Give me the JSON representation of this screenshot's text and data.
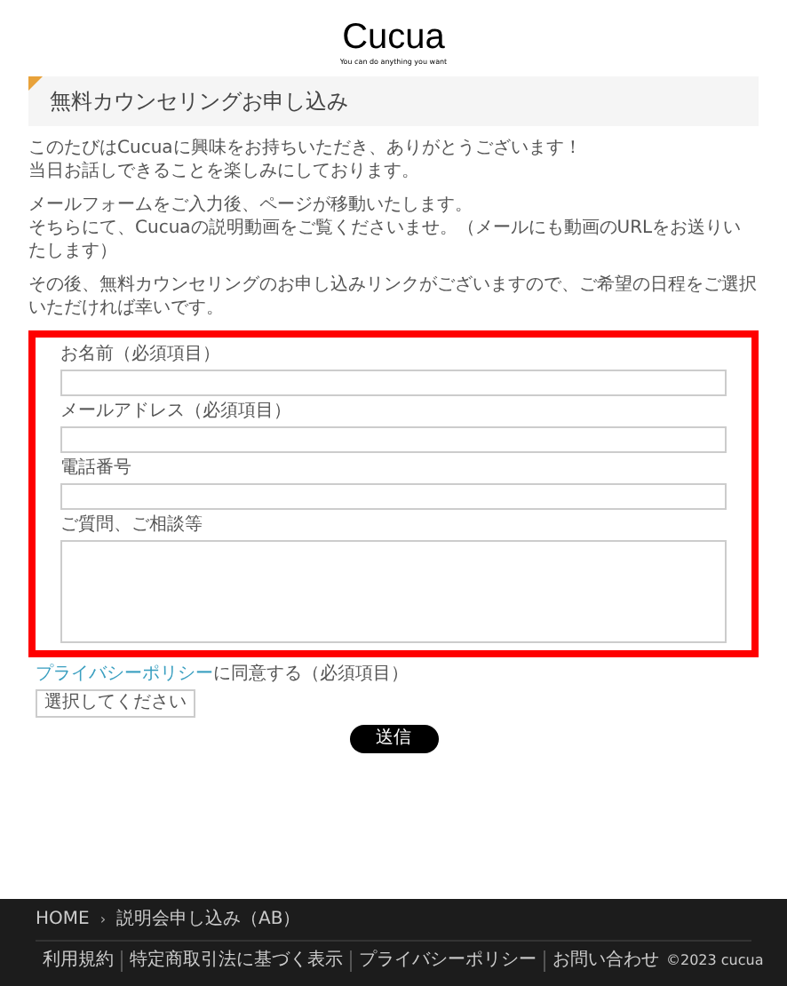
{
  "logo": {
    "text": "Cucua",
    "tagline": "You can do anything you want"
  },
  "heading": "無料カウンセリングお申し込み",
  "paragraphs": [
    {
      "lines": [
        "このたびはCucuaに興味をお持ちいただき、ありがとうございます！",
        "当日お話しできることを楽しみにしております。"
      ]
    },
    {
      "lines": [
        "メールフォームをご入力後、ページが移動いたします。",
        "そちらにて、Cucuaの説明動画をご覧くださいませ。（メールにも動画のURLをお送りいたします）"
      ]
    },
    {
      "lines": [
        "その後、無料カウンセリングのお申し込みリンクがございますので、ご希望の日程をご選択いただければ幸いです。"
      ]
    }
  ],
  "form": {
    "fields": [
      {
        "label": "お名前（必須項目）",
        "kind": "input"
      },
      {
        "label": "メールアドレス（必須項目）",
        "kind": "input"
      },
      {
        "label": "電話番号",
        "kind": "input"
      },
      {
        "label": "ご質問、ご相談等",
        "kind": "textarea"
      }
    ]
  },
  "consent": {
    "link": "プライバシーポリシー",
    "text": "に同意する（必須項目）",
    "select_placeholder": "選択してください"
  },
  "submit": "送信",
  "footer": {
    "breadcrumbs": [
      "HOME",
      "説明会申し込み（AB）"
    ],
    "separator": "›",
    "links": [
      "利用規約",
      "特定商取引法に基づく表示",
      "プライバシーポリシー",
      "お問い合わせ"
    ],
    "copyright": "©2023 cucua"
  }
}
